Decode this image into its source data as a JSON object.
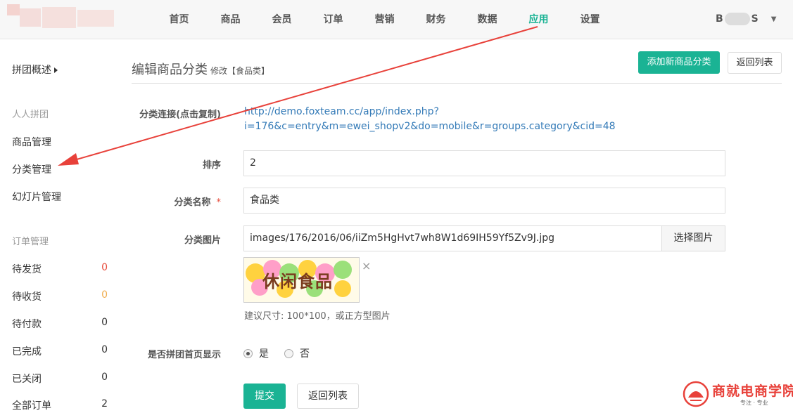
{
  "nav": {
    "items": [
      "首页",
      "商品",
      "会员",
      "订单",
      "营销",
      "财务",
      "数据",
      "应用",
      "设置"
    ],
    "active_index": 7,
    "user": {
      "prefix": "B",
      "suffix": "S"
    }
  },
  "sidebar": {
    "overview": "拼团概述",
    "section1": "人人拼团",
    "items": [
      "商品管理",
      "分类管理",
      "幻灯片管理"
    ],
    "section2": "订单管理",
    "orders": [
      {
        "label": "待发货",
        "count": "0",
        "color": "#e74c3c"
      },
      {
        "label": "待收货",
        "count": "0",
        "color": "#f0ad4e"
      },
      {
        "label": "待付款",
        "count": "0",
        "color": "#333333"
      },
      {
        "label": "已完成",
        "count": "0",
        "color": "#333333"
      },
      {
        "label": "已关闭",
        "count": "0",
        "color": "#333333"
      },
      {
        "label": "全部订单",
        "count": "2",
        "color": "#333333"
      }
    ]
  },
  "page": {
    "title": "编辑商品分类",
    "subtitle": "修改【食品类】",
    "add_button": "添加新商品分类",
    "back_button": "返回列表"
  },
  "form": {
    "link_label": "分类连接(点击复制)",
    "link_line1": "http://demo.foxteam.cc/app/index.php?",
    "link_line2": "i=176&c=entry&m=ewei_shopv2&do=mobile&r=groups.category&cid=48",
    "order_label": "排序",
    "order_value": "2",
    "name_label": "分类名称",
    "required_mark": "*",
    "name_value": "食品类",
    "image_label": "分类图片",
    "image_value": "images/176/2016/06/iiZm5HgHvt7wh8W1d69IH59Yf5Zv9J.jpg",
    "image_button": "选择图片",
    "thumb_text": "休闲食品",
    "remove_icon": "×",
    "hint": "建议尺寸: 100*100，或正方型图片",
    "show_label": "是否拼团首页显示",
    "radio_yes": "是",
    "radio_no": "否",
    "submit": "提交",
    "back": "返回列表"
  },
  "watermark": {
    "name": "商就电商学院",
    "slogan": "专注 · 专业"
  },
  "colors": {
    "accent": "#1ab394",
    "arrow": "#e8413a",
    "link": "#337ab7"
  }
}
